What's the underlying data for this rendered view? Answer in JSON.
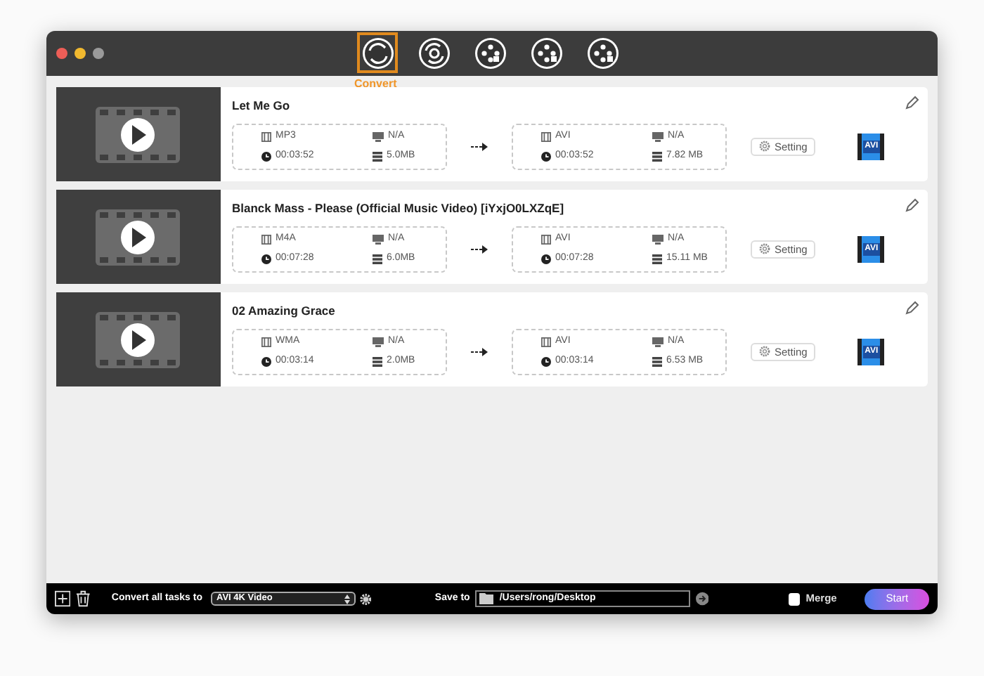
{
  "tabs": [
    {
      "label": "Convert",
      "selected": true
    },
    {
      "selected": false
    },
    {
      "selected": false
    },
    {
      "selected": false
    },
    {
      "selected": false
    }
  ],
  "files": [
    {
      "title": "Let Me Go",
      "source": {
        "format": "MP3",
        "resolution": "N/A",
        "duration": "00:03:52",
        "size": "5.0MB"
      },
      "target": {
        "format": "AVI",
        "resolution": "N/A",
        "duration": "00:03:52",
        "size": "7.82 MB"
      },
      "setting": "Setting",
      "badge": "AVI"
    },
    {
      "title": "Blanck Mass - Please (Official Music Video) [iYxjO0LXZqE]",
      "source": {
        "format": "M4A",
        "resolution": "N/A",
        "duration": "00:07:28",
        "size": "6.0MB"
      },
      "target": {
        "format": "AVI",
        "resolution": "N/A",
        "duration": "00:07:28",
        "size": "15.11 MB"
      },
      "setting": "Setting",
      "badge": "AVI"
    },
    {
      "title": "02 Amazing Grace",
      "source": {
        "format": "WMA",
        "resolution": "N/A",
        "duration": "00:03:14",
        "size": "2.0MB"
      },
      "target": {
        "format": "AVI",
        "resolution": "N/A",
        "duration": "00:03:14",
        "size": "6.53 MB"
      },
      "setting": "Setting",
      "badge": "AVI"
    }
  ],
  "bottom": {
    "convert_label": "Convert all tasks to",
    "format": "AVI 4K Video",
    "save_label": "Save to",
    "path": "/Users/rong/Desktop",
    "merge": {
      "label": "Merge",
      "checked": false
    },
    "start": "Start"
  }
}
